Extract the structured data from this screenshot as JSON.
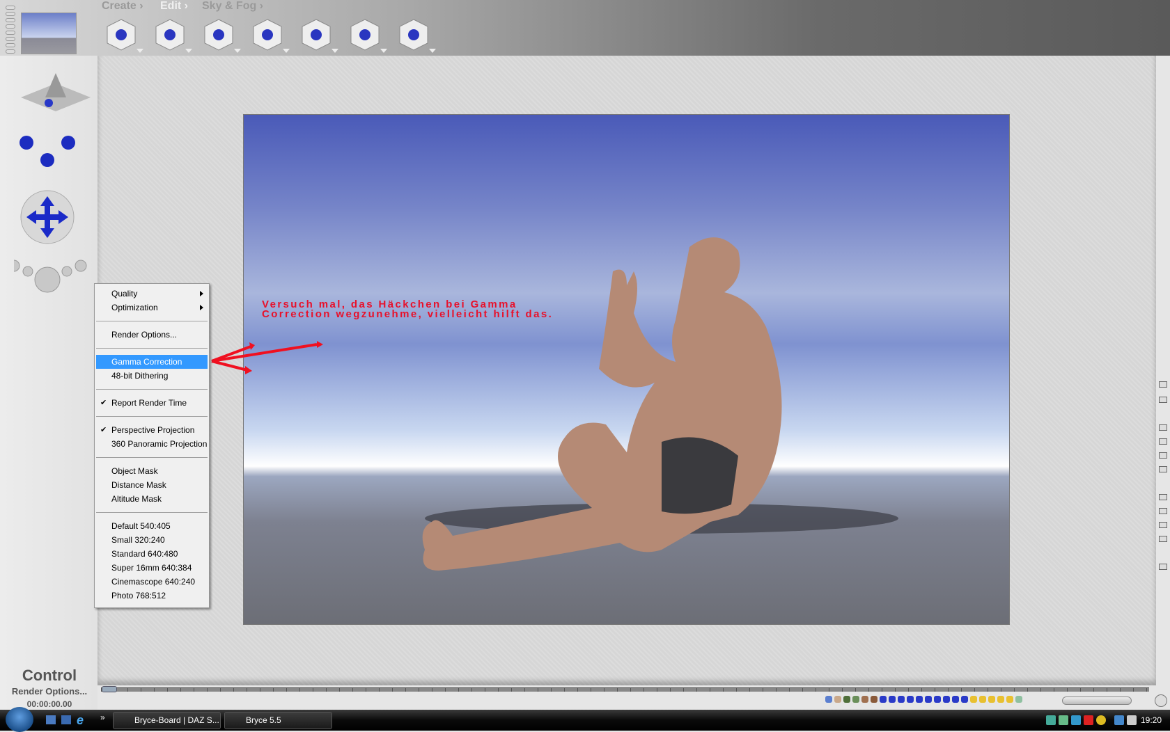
{
  "toolbar": {
    "tabs": [
      {
        "label": "Create ›"
      },
      {
        "label": "Edit ›"
      },
      {
        "label": "Sky & Fog ›"
      }
    ],
    "tools": [
      "create-cube-tool",
      "edit-tool",
      "rotate-tool",
      "resize-tool",
      "align-tool",
      "randomize-tool",
      "terrain-tool"
    ]
  },
  "annotation": {
    "line1": "Versuch mal, das Häckchen bei Gamma",
    "line2": "Correction wegzunehme, vielleicht hilft das.",
    "color": "#e8102a"
  },
  "menu": {
    "items": [
      {
        "label": "Quality",
        "submenu": true
      },
      {
        "label": "Optimization",
        "submenu": true
      },
      {
        "sep": true
      },
      {
        "label": "Render Options..."
      },
      {
        "sep": true
      },
      {
        "label": "Gamma Correction",
        "highlighted": true
      },
      {
        "label": "48-bit Dithering"
      },
      {
        "sep": true
      },
      {
        "label": "Report Render Time",
        "checked": true
      },
      {
        "sep": true
      },
      {
        "label": "Perspective Projection",
        "checked": true
      },
      {
        "label": "360 Panoramic Projection"
      },
      {
        "sep": true
      },
      {
        "label": "Object Mask"
      },
      {
        "label": "Distance Mask"
      },
      {
        "label": "Altitude Mask"
      },
      {
        "sep": true
      },
      {
        "label": "Default 540:405"
      },
      {
        "label": "Small 320:240"
      },
      {
        "label": "Standard 640:480"
      },
      {
        "label": "Super 16mm 640:384"
      },
      {
        "label": "Cinemascope 640:240"
      },
      {
        "label": "Photo 768:512"
      }
    ],
    "highlight_color": "#3399ff"
  },
  "status": {
    "title": "Control",
    "subtitle": "Render Options...",
    "time": "00:00:00.00"
  },
  "taskbar": {
    "tasks": [
      {
        "label": "Bryce-Board | DAZ S..."
      },
      {
        "label": "Bryce 5.5"
      }
    ],
    "clock": "19:20",
    "overflow": "»"
  }
}
